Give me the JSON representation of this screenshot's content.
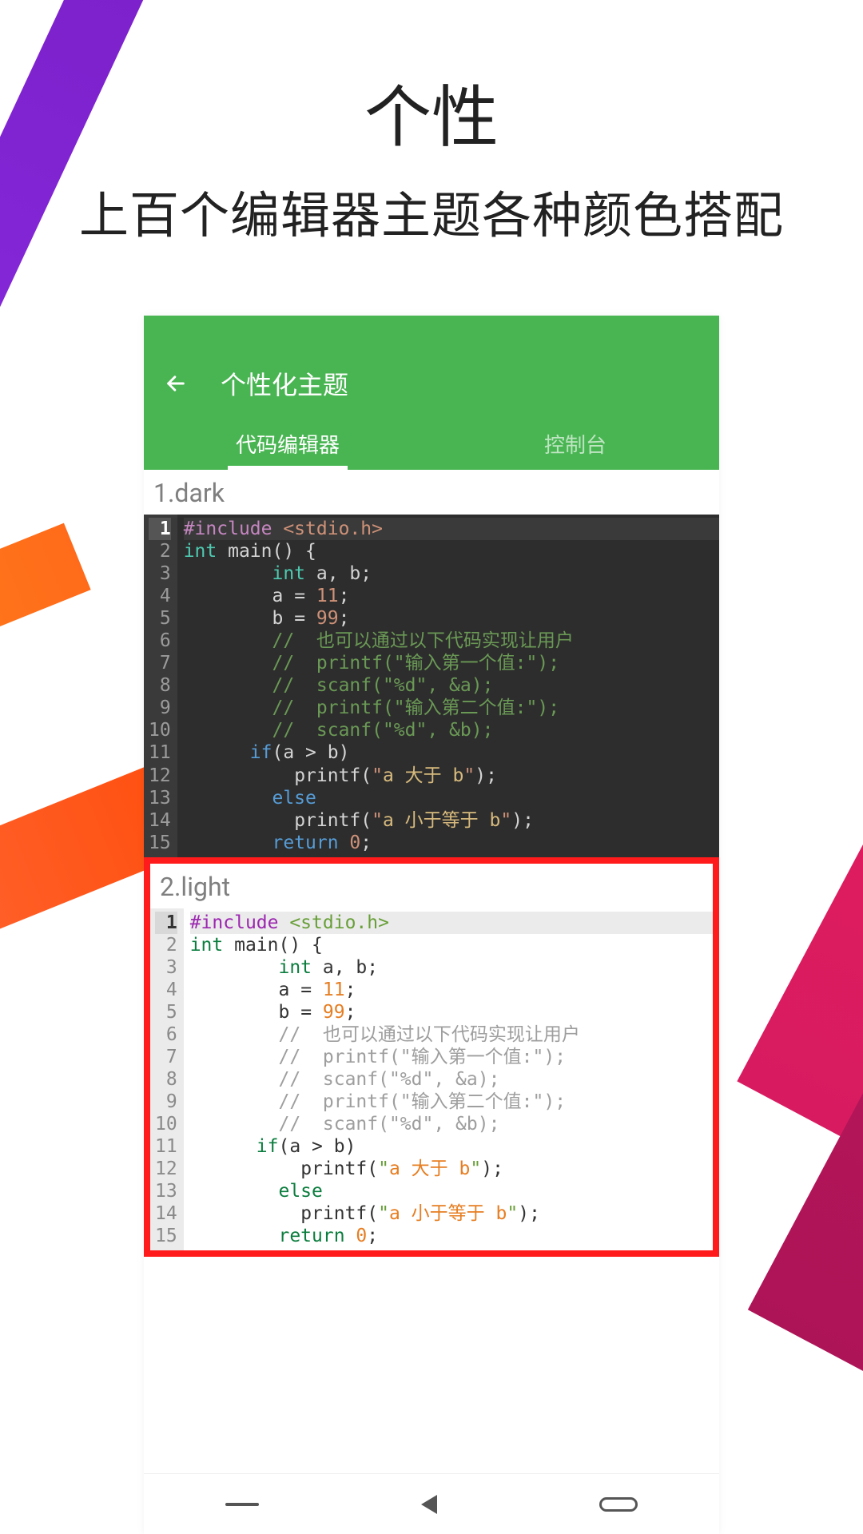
{
  "hero": {
    "title": "个性",
    "subtitle": "上百个编辑器主题各种颜色搭配"
  },
  "appbar": {
    "title": "个性化主题"
  },
  "tabs": {
    "active": "代码编辑器",
    "inactive": "控制台"
  },
  "themes": [
    {
      "label": "1.dark"
    },
    {
      "label": "2.light"
    }
  ],
  "code": {
    "lines": [
      {
        "n": "1",
        "seg": [
          [
            "pre",
            "#include "
          ],
          [
            "str",
            "<stdio.h>"
          ]
        ]
      },
      {
        "n": "2",
        "seg": [
          [
            "typ",
            "int "
          ],
          [
            "id",
            "main"
          ],
          [
            "op",
            "() {"
          ]
        ]
      },
      {
        "n": "3",
        "seg": [
          [
            "pad",
            "        "
          ],
          [
            "typ",
            "int "
          ],
          [
            "id",
            "a, b;"
          ]
        ]
      },
      {
        "n": "4",
        "seg": [
          [
            "pad",
            "        "
          ],
          [
            "id",
            "a "
          ],
          [
            "op",
            "= "
          ],
          [
            "num",
            "11"
          ],
          [
            "op",
            ";"
          ]
        ]
      },
      {
        "n": "5",
        "seg": [
          [
            "pad",
            "        "
          ],
          [
            "id",
            "b "
          ],
          [
            "op",
            "= "
          ],
          [
            "num",
            "99"
          ],
          [
            "op",
            ";"
          ]
        ]
      },
      {
        "n": "6",
        "seg": [
          [
            "pad",
            "        "
          ],
          [
            "cmt",
            "//  也可以通过以下代码实现让用户"
          ]
        ]
      },
      {
        "n": "7",
        "seg": [
          [
            "pad",
            "        "
          ],
          [
            "cmt",
            "//  printf(\"输入第一个值:\");"
          ]
        ]
      },
      {
        "n": "8",
        "seg": [
          [
            "pad",
            "        "
          ],
          [
            "cmt",
            "//  scanf(\"%d\", &a);"
          ]
        ]
      },
      {
        "n": "9",
        "seg": [
          [
            "pad",
            "        "
          ],
          [
            "cmt",
            "//  printf(\"输入第二个值:\");"
          ]
        ]
      },
      {
        "n": "10",
        "seg": [
          [
            "pad",
            "        "
          ],
          [
            "cmt",
            "//  scanf(\"%d\", &b);"
          ]
        ]
      },
      {
        "n": "11",
        "seg": [
          [
            "pad",
            "      "
          ],
          [
            "kw",
            "if"
          ],
          [
            "op",
            "(a > b)"
          ]
        ]
      },
      {
        "n": "12",
        "seg": [
          [
            "pad",
            "          "
          ],
          [
            "id",
            "printf("
          ],
          [
            "str",
            "\""
          ],
          [
            "strcn",
            "a 大于 b"
          ],
          [
            "str",
            "\""
          ],
          [
            "op",
            ");"
          ]
        ]
      },
      {
        "n": "13",
        "seg": [
          [
            "pad",
            "        "
          ],
          [
            "kw",
            "else"
          ]
        ]
      },
      {
        "n": "14",
        "seg": [
          [
            "pad",
            "          "
          ],
          [
            "id",
            "printf("
          ],
          [
            "str",
            "\""
          ],
          [
            "strcn",
            "a 小于等于 b"
          ],
          [
            "str",
            "\""
          ],
          [
            "op",
            ");"
          ]
        ]
      },
      {
        "n": "15",
        "seg": [
          [
            "pad",
            "        "
          ],
          [
            "kw",
            "return "
          ],
          [
            "num",
            "0"
          ],
          [
            "op",
            ";"
          ]
        ]
      }
    ]
  }
}
